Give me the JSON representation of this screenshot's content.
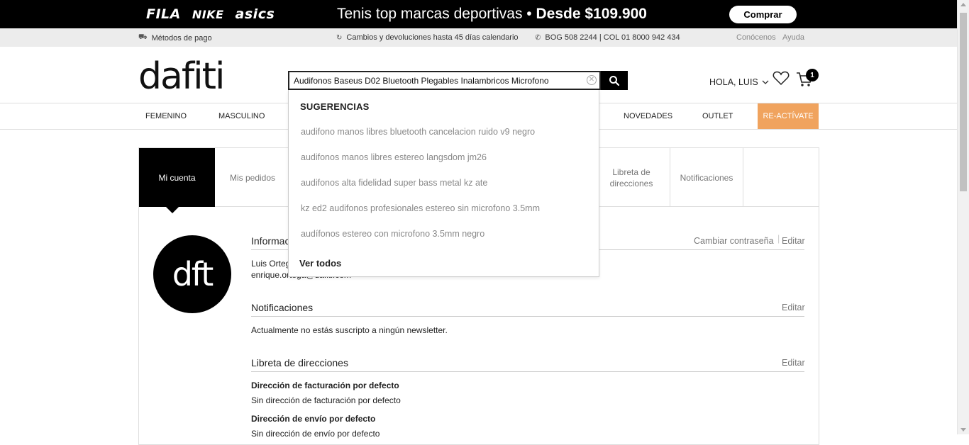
{
  "promo": {
    "brands": [
      "FILA",
      "NIKE",
      "asics"
    ],
    "headline_plain": "Tenis top marcas deportivas •",
    "headline_bold": "Desde $109.900",
    "buy_label": "Comprar"
  },
  "infobar": {
    "payment": "Métodos de pago",
    "returns": "Cambios y devoluciones hasta 45 días calendario",
    "phone": "BOG 508 2244 | COL 01 8000 942 434",
    "about": "Conócenos",
    "help": "Ayuda"
  },
  "header": {
    "logo": "dafiti",
    "search_value": "Audifonos Baseus D02 Bluetooth Plegables Inalambricos Microfono",
    "greeting": "HOLA, LUIS",
    "cart_count": "1"
  },
  "nav": {
    "items": [
      "FEMENINO",
      "MASCULINO",
      "NOVEDADES",
      "OUTLET"
    ],
    "reactivate": "RE-ACTÍVATE"
  },
  "account": {
    "tabs": [
      "Mi cuenta",
      "Mis pedidos",
      "Libreta de direcciones",
      "Notificaciones"
    ],
    "avatar_text": "dft",
    "info": {
      "title": "Información",
      "change_password": "Cambiar contraseña",
      "edit": "Editar",
      "name": "Luis Ortega",
      "email": "enrique.ortega@dafiti.com"
    },
    "notifications": {
      "title": "Notificaciones",
      "edit": "Editar",
      "text": "Actualmente no estás suscripto a ningún newsletter."
    },
    "addresses": {
      "title": "Libreta de direcciones",
      "edit": "Editar",
      "billing_title": "Dirección de facturación por defecto",
      "billing_text": "Sin dirección de facturación por defecto",
      "shipping_title": "Dirección de envío por defecto",
      "shipping_text": "Sin dirección de envío por defecto"
    }
  },
  "suggestions": {
    "title": "SUGERENCIAS",
    "items": [
      "audifono manos libres bluetooth cancelacion ruido v9 negro",
      "audifonos manos libres estereo langsdom jm26",
      "audifonos alta fidelidad super bass metal kz ate",
      "kz ed2 audifonos profesionales estereo sin microfono 3.5mm",
      "audífonos estereo con microfono 3.5mm negro"
    ],
    "see_all": "Ver todos"
  },
  "colors": {
    "accent": "#f0a35e",
    "promo_bg": "#000000",
    "infobar_bg": "#ececec"
  }
}
